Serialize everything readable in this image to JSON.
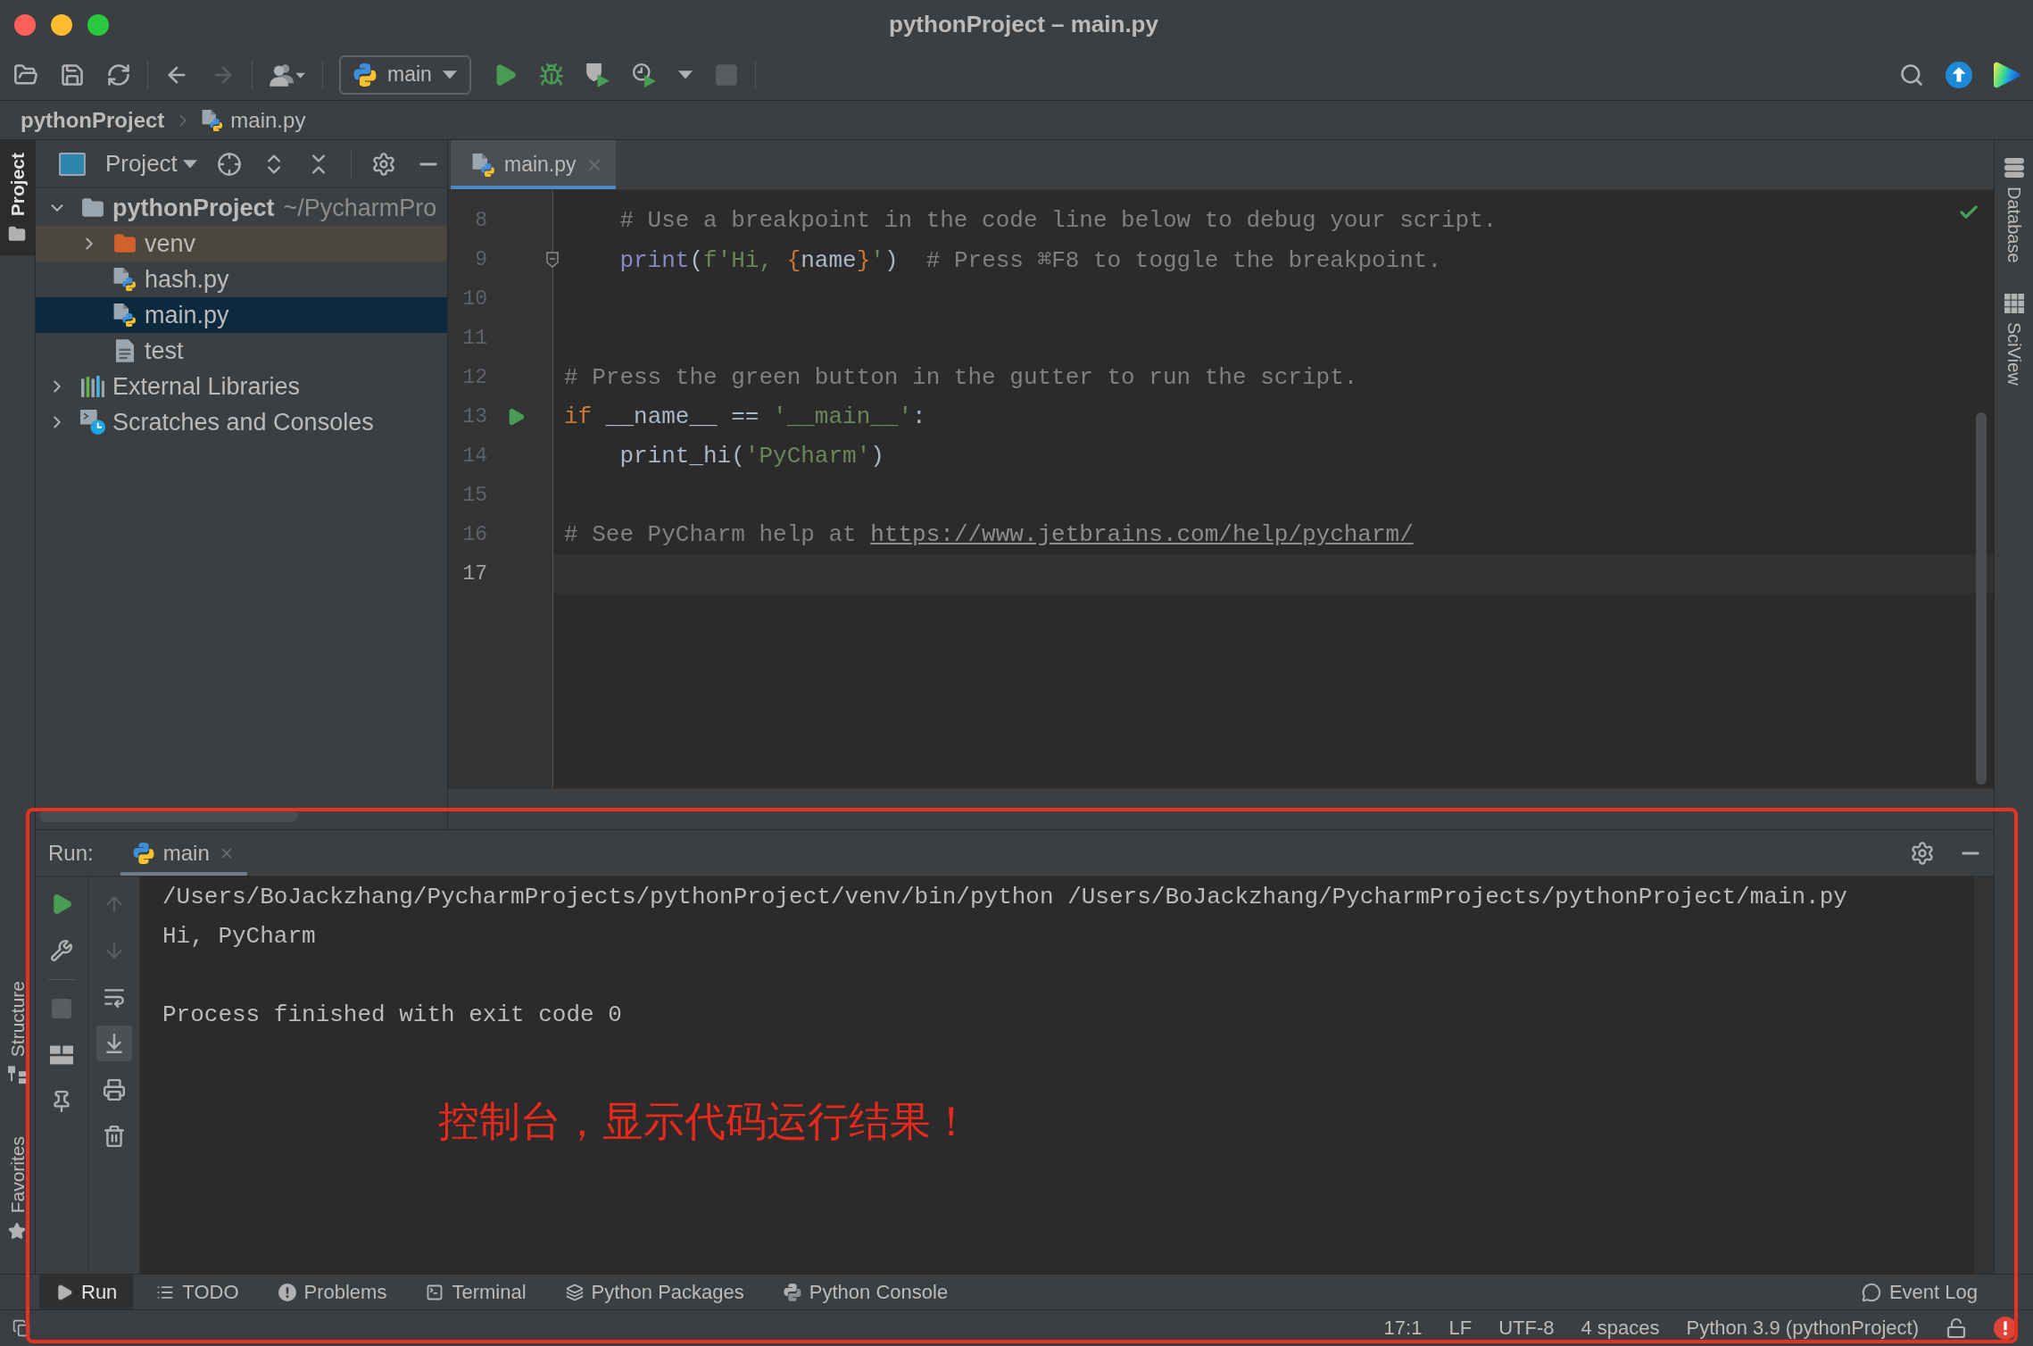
{
  "window": {
    "title": "pythonProject – main.py"
  },
  "toolbar": {
    "groups": [
      [
        {
          "kind": "open",
          "disabled": false
        },
        {
          "kind": "save",
          "disabled": false
        },
        {
          "kind": "sync",
          "disabled": false
        }
      ],
      [
        {
          "kind": "back",
          "disabled": false
        },
        {
          "kind": "forward",
          "disabled": true
        }
      ],
      [
        {
          "kind": "vcs",
          "disabled": false
        }
      ]
    ],
    "run_config": {
      "label": "main"
    },
    "run_actions": [
      {
        "kind": "run",
        "disabled": false
      },
      {
        "kind": "debug",
        "disabled": false
      },
      {
        "kind": "coverage",
        "disabled": false
      },
      {
        "kind": "profile",
        "disabled": false
      },
      {
        "kind": "more",
        "disabled": false
      },
      {
        "kind": "stop",
        "disabled": true
      }
    ],
    "right": [
      {
        "kind": "search"
      },
      {
        "kind": "update"
      },
      {
        "kind": "toolbox"
      }
    ]
  },
  "breadcrumbs": [
    {
      "label": "pythonProject",
      "kind": "project"
    },
    {
      "label": "main.py",
      "kind": "python-file"
    }
  ],
  "left_strip": {
    "top": [
      {
        "label": "Project",
        "kind": "project",
        "selected": true
      }
    ],
    "bottom": [
      {
        "label": "Structure",
        "kind": "structure",
        "selected": false
      },
      {
        "label": "Favorites",
        "kind": "favorites",
        "selected": false
      }
    ]
  },
  "project_panel": {
    "title": "Project",
    "tree": [
      {
        "label": "pythonProject",
        "note": "~/PycharmPro",
        "kind": "project-folder",
        "expanded": true,
        "selected": false,
        "children": [
          {
            "label": "venv",
            "kind": "excluded-folder",
            "expanded": false,
            "selected": false
          },
          {
            "label": "hash.py",
            "kind": "python-file",
            "selected": false
          },
          {
            "label": "main.py",
            "kind": "python-file",
            "selected": true
          },
          {
            "label": "test",
            "kind": "text-file",
            "selected": false
          }
        ]
      },
      {
        "label": "External Libraries",
        "kind": "libraries",
        "expanded": false,
        "selected": false
      },
      {
        "label": "Scratches and Consoles",
        "kind": "scratches",
        "expanded": false,
        "selected": false
      }
    ]
  },
  "editor": {
    "tabs": [
      {
        "label": "main.py",
        "selected": true
      }
    ],
    "lines": [
      {
        "number": "8",
        "current": false,
        "indented": true,
        "tokens": [
          {
            "kind": "comment",
            "text": "# Use a breakpoint in the code line below to debug your script."
          }
        ]
      },
      {
        "number": "9",
        "current": false,
        "indented": true,
        "gutter": {
          "kind": "fold"
        },
        "tokens": [
          {
            "kind": "builtin",
            "text": "print"
          },
          {
            "kind": "plain",
            "text": "("
          },
          {
            "kind": "string",
            "text": "f'Hi, "
          },
          {
            "kind": "brace",
            "text": "{"
          },
          {
            "kind": "plain",
            "text": "name"
          },
          {
            "kind": "brace",
            "text": "}"
          },
          {
            "kind": "string",
            "text": "'"
          },
          {
            "kind": "plain",
            "text": ")  "
          },
          {
            "kind": "comment",
            "text": "# Press ⌘F8 to toggle the breakpoint."
          }
        ]
      },
      {
        "number": "10",
        "current": false
      },
      {
        "number": "11",
        "current": false
      },
      {
        "number": "12",
        "current": false,
        "indented": false,
        "tokens": [
          {
            "kind": "comment",
            "text": "# Press the green button in the gutter to run the script."
          }
        ]
      },
      {
        "number": "13",
        "current": false,
        "indented": false,
        "gutter": {
          "kind": "run"
        },
        "tokens": [
          {
            "kind": "keyword",
            "text": "if"
          },
          {
            "kind": "plain",
            "text": " __name__ == "
          },
          {
            "kind": "string",
            "text": "'__main__'"
          },
          {
            "kind": "plain",
            "text": ":"
          }
        ]
      },
      {
        "number": "14",
        "current": false,
        "indented": true,
        "tokens": [
          {
            "kind": "plain",
            "text": "print_hi("
          },
          {
            "kind": "string",
            "text": "'PyCharm'"
          },
          {
            "kind": "plain",
            "text": ")"
          }
        ]
      },
      {
        "number": "15",
        "current": false
      },
      {
        "number": "16",
        "current": false,
        "indented": false,
        "tokens": [
          {
            "kind": "comment",
            "text": "# See PyCharm help at "
          },
          {
            "kind": "link",
            "text": "https://www.jetbrains.com/help/pycharm/"
          }
        ]
      },
      {
        "number": "17",
        "current": true
      }
    ]
  },
  "right_strip": [
    {
      "label": "Database",
      "kind": "database"
    },
    {
      "label": "SciView",
      "kind": "sciview"
    }
  ],
  "run_panel": {
    "label": "Run:",
    "tabs": [
      {
        "label": "main",
        "selected": true
      }
    ],
    "tools": [
      [
        {
          "kind": "rerun",
          "disabled": false,
          "on": false
        },
        {
          "kind": "wrench",
          "disabled": false,
          "on": false
        },
        {
          "kind": "stop",
          "disabled": true,
          "on": false
        },
        {
          "kind": "layout",
          "disabled": false,
          "on": false
        },
        {
          "kind": "pin",
          "disabled": false,
          "on": false
        }
      ],
      [
        {
          "kind": "up",
          "disabled": true,
          "on": false
        },
        {
          "kind": "down",
          "disabled": true,
          "on": false
        },
        {
          "kind": "wrap",
          "disabled": false,
          "on": false
        },
        {
          "kind": "scroll-end",
          "disabled": false,
          "on": true
        },
        {
          "kind": "print",
          "disabled": false,
          "on": false
        },
        {
          "kind": "trash",
          "disabled": false,
          "on": false
        }
      ]
    ],
    "output": [
      {
        "kind": "command",
        "text": "/Users/BoJackzhang/PycharmProjects/pythonProject/venv/bin/python /Users/BoJackzhang/PycharmProjects/pythonProject/main.py"
      },
      {
        "kind": "stdout",
        "text": "Hi, PyCharm"
      },
      {
        "kind": "exit",
        "text": "Process finished with exit code 0"
      }
    ]
  },
  "annotation": {
    "text": "控制台，显示代码运行结果！"
  },
  "tool_windows": {
    "left": [
      {
        "label": "Run",
        "kind": "run",
        "selected": true
      },
      {
        "label": "TODO",
        "kind": "todo",
        "selected": false
      },
      {
        "label": "Problems",
        "kind": "problems",
        "selected": false
      },
      {
        "label": "Terminal",
        "kind": "terminal",
        "selected": false
      },
      {
        "label": "Python Packages",
        "kind": "packages",
        "selected": false
      },
      {
        "label": "Python Console",
        "kind": "console",
        "selected": false
      }
    ],
    "right": [
      {
        "label": "Event Log",
        "kind": "event-log",
        "selected": false
      }
    ]
  },
  "status_bar": {
    "items": [
      "17:1",
      "LF",
      "UTF-8",
      "4 spaces",
      "Python 3.9 (pythonProject)"
    ]
  }
}
